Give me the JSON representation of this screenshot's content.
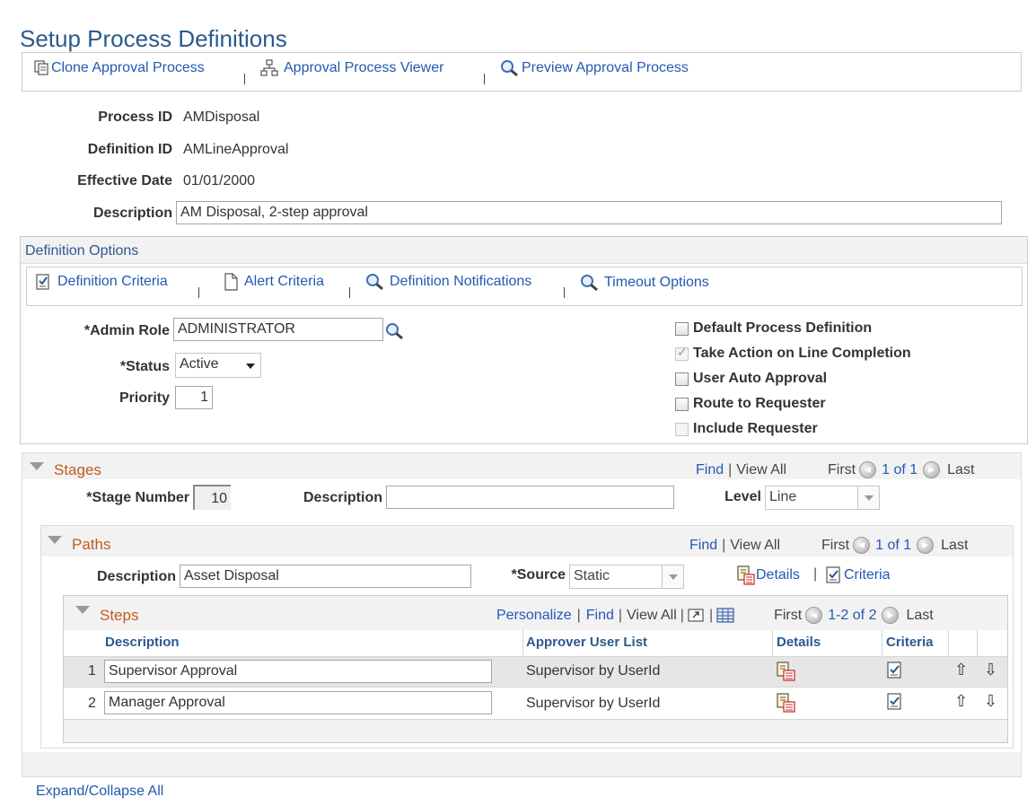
{
  "page": {
    "title": "Setup Process Definitions",
    "toolbar": {
      "clone": "Clone Approval Process",
      "viewer": "Approval Process Viewer",
      "preview": "Preview Approval Process"
    },
    "sep": "|"
  },
  "header_fields": {
    "process_id_label": "Process ID",
    "process_id": "AMDisposal",
    "definition_id_label": "Definition ID",
    "definition_id": "AMLineApproval",
    "effective_date_label": "Effective Date",
    "effective_date": "01/01/2000",
    "description_label": "Description",
    "description": "AM Disposal, 2-step approval"
  },
  "definition_options": {
    "title": "Definition Options",
    "links": {
      "definition_criteria": "Definition Criteria",
      "alert_criteria": "Alert Criteria",
      "definition_notifications": "Definition Notifications",
      "timeout_options": "Timeout Options"
    },
    "admin_role_label": "*Admin Role",
    "admin_role": "ADMINISTRATOR",
    "status_label": "*Status",
    "status": "Active",
    "priority_label": "Priority",
    "priority": "1",
    "checkboxes": [
      {
        "label": "Default Process Definition",
        "checked": false,
        "disabled": false
      },
      {
        "label": "Take Action on Line Completion",
        "checked": true,
        "disabled": true
      },
      {
        "label": "User Auto Approval",
        "checked": false,
        "disabled": false
      },
      {
        "label": "Route to Requester",
        "checked": false,
        "disabled": false
      },
      {
        "label": "Include Requester",
        "checked": false,
        "disabled": true
      }
    ]
  },
  "stages": {
    "title": "Stages",
    "find": "Find",
    "view_all": "View All",
    "first": "First",
    "counter": "1 of 1",
    "last": "Last",
    "stage_number_label": "*Stage Number",
    "stage_number": "10",
    "description_label": "Description",
    "description": "",
    "level_label": "Level",
    "level": "Line"
  },
  "paths": {
    "title": "Paths",
    "find": "Find",
    "view_all": "View All",
    "first": "First",
    "counter": "1 of 1",
    "last": "Last",
    "description_label": "Description",
    "description": "Asset Disposal",
    "source_label": "*Source",
    "source": "Static",
    "details": "Details",
    "criteria": "Criteria"
  },
  "steps": {
    "title": "Steps",
    "personalize": "Personalize",
    "find": "Find",
    "view_all": "View All",
    "first": "First",
    "counter": "1-2 of 2",
    "last": "Last",
    "columns": {
      "description": "Description",
      "approver": "Approver User List",
      "details": "Details",
      "criteria": "Criteria"
    },
    "rows": [
      {
        "num": "1",
        "description": "Supervisor Approval",
        "approver": "Supervisor by UserId"
      },
      {
        "num": "2",
        "description": "Manager Approval",
        "approver": "Supervisor by UserId"
      }
    ]
  },
  "footer": {
    "expand_collapse": "Expand/Collapse All"
  },
  "colors": {
    "link": "#2359b1",
    "title": "#2c5a8c",
    "section_header": "#c05c1d",
    "highlight_row": "#e6e6e6"
  }
}
